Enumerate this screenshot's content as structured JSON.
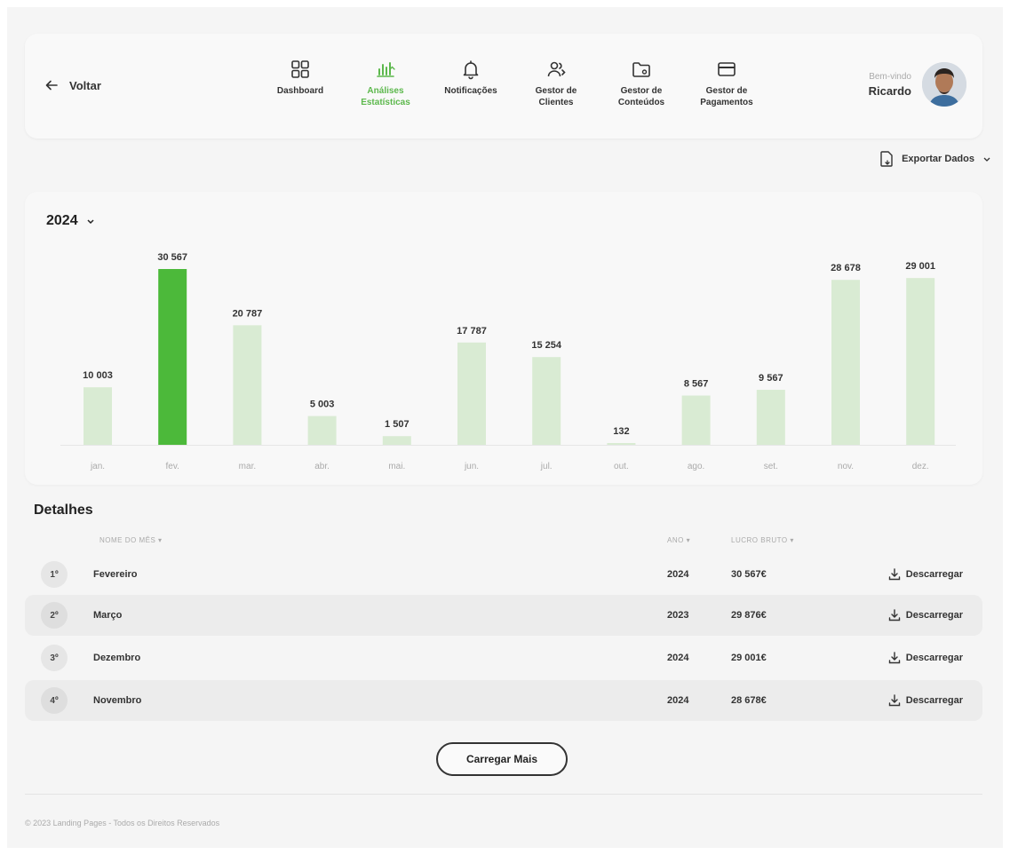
{
  "header": {
    "back_label": "Voltar",
    "nav": [
      {
        "label_1": "Dashboard",
        "label_2": "",
        "icon": "grid-icon",
        "active": false
      },
      {
        "label_1": "Análises",
        "label_2": "Estatísticas",
        "icon": "bar-chart-icon",
        "active": true
      },
      {
        "label_1": "Notificações",
        "label_2": "",
        "icon": "bell-icon",
        "active": false
      },
      {
        "label_1": "Gestor de",
        "label_2": "Clientes",
        "icon": "users-icon",
        "active": false
      },
      {
        "label_1": "Gestor de",
        "label_2": "Conteúdos",
        "icon": "folder-icon",
        "active": false
      },
      {
        "label_1": "Gestor de",
        "label_2": "Pagamentos",
        "icon": "card-icon",
        "active": false
      }
    ],
    "greeting": "Bem-vindo",
    "user_name": "Ricardo"
  },
  "export_label": "Exportar Dados",
  "year_label": "2024",
  "colors": {
    "accent": "#5cb84c",
    "bar_light": "#d9ebd3",
    "bar_highlight": "#4cb93a"
  },
  "chart_data": {
    "type": "bar",
    "categories": [
      "jan.",
      "fev.",
      "mar.",
      "abr.",
      "mai.",
      "jun.",
      "jul.",
      "out.",
      "ago.",
      "set.",
      "nov.",
      "dez."
    ],
    "values": [
      10003,
      30567,
      20787,
      5003,
      1507,
      17787,
      15254,
      132,
      8567,
      9567,
      28678,
      29001
    ],
    "value_labels": [
      "10 003",
      "30 567",
      "20 787",
      "5 003",
      "1 507",
      "17 787",
      "15 254",
      "132",
      "8 567",
      "9 567",
      "28 678",
      "29 001"
    ],
    "highlight_index": 1,
    "title": "",
    "xlabel": "",
    "ylabel": "",
    "grid": false,
    "legend": "none"
  },
  "details": {
    "title": "Detalhes",
    "columns": {
      "month": "NOME DO MÊS",
      "year": "ANO",
      "profit": "LUCRO BRUTO"
    },
    "rows": [
      {
        "rank": "1º",
        "month": "Fevereiro",
        "year": "2024",
        "profit": "30 567€",
        "action": "Descarregar"
      },
      {
        "rank": "2º",
        "month": "Março",
        "year": "2023",
        "profit": "29 876€",
        "action": "Descarregar"
      },
      {
        "rank": "3º",
        "month": "Dezembro",
        "year": "2024",
        "profit": "29 001€",
        "action": "Descarregar"
      },
      {
        "rank": "4º",
        "month": "Novembro",
        "year": "2024",
        "profit": "28 678€",
        "action": "Descarregar"
      }
    ],
    "load_more": "Carregar Mais"
  },
  "footer": "© 2023 Landing Pages - Todos os Direitos Reservados"
}
